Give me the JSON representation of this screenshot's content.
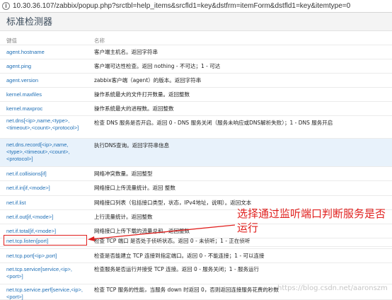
{
  "address_bar": {
    "url": "10.30.36.107/zabbix/popup.php?srctbl=help_items&srcfld1=key&dstfrm=itemForm&dstfld1=key&itemtype=0",
    "icon": "info-icon"
  },
  "page": {
    "title": "标准检测器"
  },
  "table": {
    "headers": {
      "key": "键值",
      "name": "名称"
    },
    "rows": [
      {
        "key": "agent.hostname",
        "desc": "客户端主机名。返回字符串"
      },
      {
        "key": "agent.ping",
        "desc": "客户端可达性检查。返回 nothing - 不可达；1 - 可达"
      },
      {
        "key": "agent.version",
        "desc": "zabbix客户端（agent）的版本。返回字符串"
      },
      {
        "key": "kernel.maxfiles",
        "desc": "操作系统最大的文件打开数量。返回整数"
      },
      {
        "key": "kernel.maxproc",
        "desc": "操作系统最大的进程数。返回整数"
      },
      {
        "key": "net.dns[<ip>,name,<type>,<timeout>,<count>,<protocol>]",
        "desc": "检查 DNS 服务是否开启。返回 0 - DNS 服务关闭（服务未响应或DNS解析失败）；1 - DNS 服务开启"
      },
      {
        "key": "net.dns.record[<ip>,name,<type>,<timeout>,<count>,<protocol>]",
        "desc": "执行DNS查询。返回字符串信息"
      },
      {
        "key": "net.if.collisions[if]",
        "desc": "网络冲突数量。返回整型"
      },
      {
        "key": "net.if.in[if,<mode>]",
        "desc": "网络接口上传流量统计。返回 整数"
      },
      {
        "key": "net.if.list",
        "desc": "网络接口列表（包括接口类型，状态，IPv4地址，说明）。返回文本"
      },
      {
        "key": "net.if.out[if,<mode>]",
        "desc": "上行流量统计。返回整数"
      },
      {
        "key": "net.if.total[if,<mode>]",
        "desc": "网络接口上传下载的流量总和。返回整数"
      },
      {
        "key": "net.tcp.listen[port]",
        "desc": "检查 TCP 端口 是否处于侦听状态。返回 0 - 未侦听；1 - 正在侦听"
      },
      {
        "key": "net.tcp.port[<ip>,port]",
        "desc": "检查是否能建立 TCP 连接到指定端口。返回 0 - 不能连接；1 - 可以连接"
      },
      {
        "key": "net.tcp.service[service,<ip>,<port>]",
        "desc": "检查服务是否运行并接受 TCP 连接。返回 0 - 服务关闭；1 - 服务运行"
      },
      {
        "key": "net.tcp.service.perf[service,<ip>,<port>]",
        "desc": "检查 TCP 服务的性能，当服务 down 时返回 0，否则返回连接服务花费的秒数"
      }
    ]
  },
  "annotation": {
    "text": "选择通过监听端口判断服务是否运行",
    "color": "#e0201e"
  },
  "watermark": "https://blog.csdn.net/aaronszm"
}
